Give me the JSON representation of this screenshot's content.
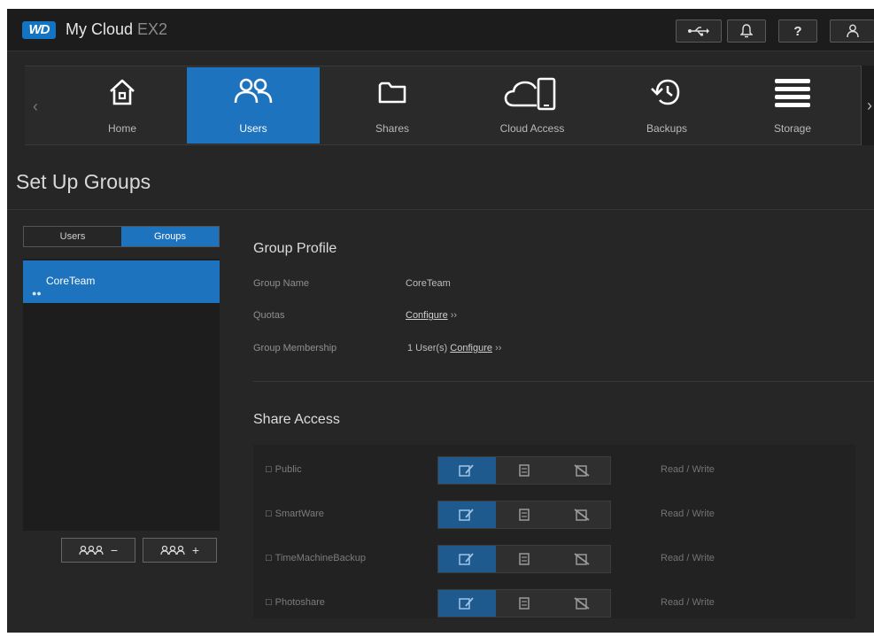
{
  "header": {
    "logo_text": "WD",
    "title": "My Cloud",
    "title_suffix": "EX2",
    "icons": [
      "usb-icon",
      "bell-icon",
      "help-icon",
      "user-icon"
    ],
    "help_glyph": "?"
  },
  "nav": {
    "items": [
      {
        "label": "Home",
        "icon": "home-icon",
        "active": false
      },
      {
        "label": "Users",
        "icon": "users-icon",
        "active": true
      },
      {
        "label": "Shares",
        "icon": "folder-icon",
        "active": false
      },
      {
        "label": "Cloud Access",
        "icon": "cloud-access-icon",
        "active": false
      },
      {
        "label": "Backups",
        "icon": "backups-icon",
        "active": false
      },
      {
        "label": "Storage",
        "icon": "storage-icon",
        "active": false
      }
    ],
    "prev_glyph": "‹",
    "next_glyph": "›"
  },
  "page_title": "Set Up Groups",
  "left_panel": {
    "tabs": [
      "Users",
      "Groups"
    ],
    "active_tab": "Groups",
    "groups": [
      "CoreTeam"
    ],
    "remove_button_symbol": "−",
    "add_button_symbol": "+"
  },
  "group_profile": {
    "title": "Group Profile",
    "group_name_label": "Group Name",
    "group_name_value": "CoreTeam",
    "quotas_label": "Quotas",
    "quotas_link": "Configure",
    "membership_label": "Group Membership",
    "membership_count": "1 User(s)",
    "membership_link": "Configure"
  },
  "share_access": {
    "title": "Share Access",
    "shares": [
      {
        "name": "Public",
        "permission": "Read / Write"
      },
      {
        "name": "SmartWare",
        "permission": "Read / Write"
      },
      {
        "name": "TimeMachineBackup",
        "permission": "Read / Write"
      },
      {
        "name": "Photoshare",
        "permission": "Read / Write"
      }
    ]
  },
  "colors": {
    "accent": "#1e73be",
    "background": "#262626",
    "topbar": "#1c1c1c"
  }
}
